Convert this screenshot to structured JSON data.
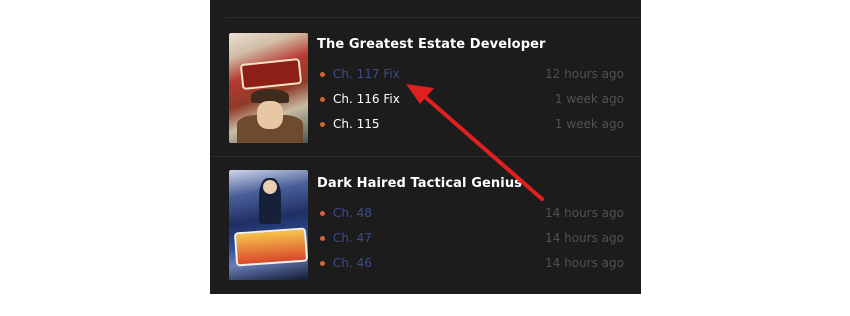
{
  "series": [
    {
      "title": "The Greatest Estate Developer",
      "chapters": [
        {
          "label": "Ch. 117 Fix",
          "time": "12 hours ago"
        },
        {
          "label": "Ch. 116 Fix",
          "time": "1 week ago"
        },
        {
          "label": "Ch. 115",
          "time": "1 week ago"
        }
      ]
    },
    {
      "title": "Dark Haired Tactical Genius",
      "chapters": [
        {
          "label": "Ch. 48",
          "time": "14 hours ago"
        },
        {
          "label": "Ch. 47",
          "time": "14 hours ago"
        },
        {
          "label": "Ch. 46",
          "time": "14 hours ago"
        }
      ]
    }
  ],
  "colors": {
    "panel_bg": "#1c1c1d",
    "bullet": "#d8613a",
    "unread_link": "#3d4b8c",
    "time_text": "#515151",
    "annotation_arrow": "#e0201f"
  },
  "icons": {
    "bullet": "dot-bullet-icon",
    "annotation": "red-arrow-annotation"
  }
}
